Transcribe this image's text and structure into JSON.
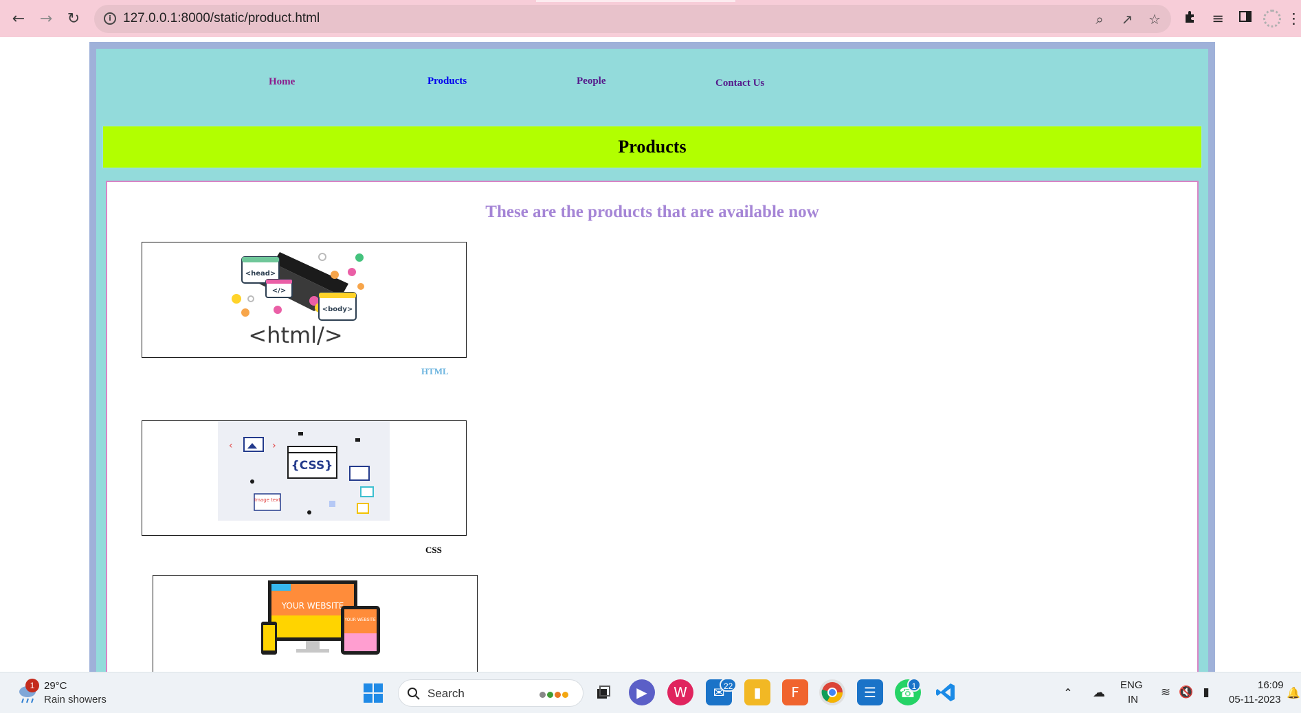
{
  "browser": {
    "url": "127.0.0.1:8000/static/product.html"
  },
  "nav": {
    "items": [
      {
        "label": "Home",
        "color": "#8b1a8b"
      },
      {
        "label": "Products",
        "color": "#0000ee"
      },
      {
        "label": "People",
        "color": "#551a8b"
      },
      {
        "label": "Contact Us",
        "color": "#551a8b"
      }
    ]
  },
  "banner": {
    "title": "Products"
  },
  "content": {
    "heading": "These are the products that are available now",
    "products": [
      {
        "label": "HTML",
        "label_color": "#6cb4df",
        "image_text": "<html/>",
        "tags": [
          "<head>",
          "</>",
          "<body>"
        ]
      },
      {
        "label": "CSS",
        "label_color": "#000000",
        "image_text": "{CSS}",
        "extra": "Image text"
      },
      {
        "image_main": "YOUR WEBSITE",
        "image_small": "YOUR WEBSITE"
      }
    ]
  },
  "taskbar": {
    "weather_temp": "29°C",
    "weather_desc": "Rain showers",
    "weather_badge": "1",
    "search_label": "Search",
    "mail_badge": "22",
    "whatsapp_badge": "1",
    "lang_top": "ENG",
    "lang_bottom": "IN",
    "time": "16:09",
    "date": "05-11-2023"
  },
  "colors": {
    "chrome": "#f7cdd8",
    "page_border": "#9fb1d9",
    "page_bg": "#93dbdb",
    "banner_bg": "#b2ff00",
    "content_border": "#d884c6",
    "heading": "#a585d6"
  }
}
